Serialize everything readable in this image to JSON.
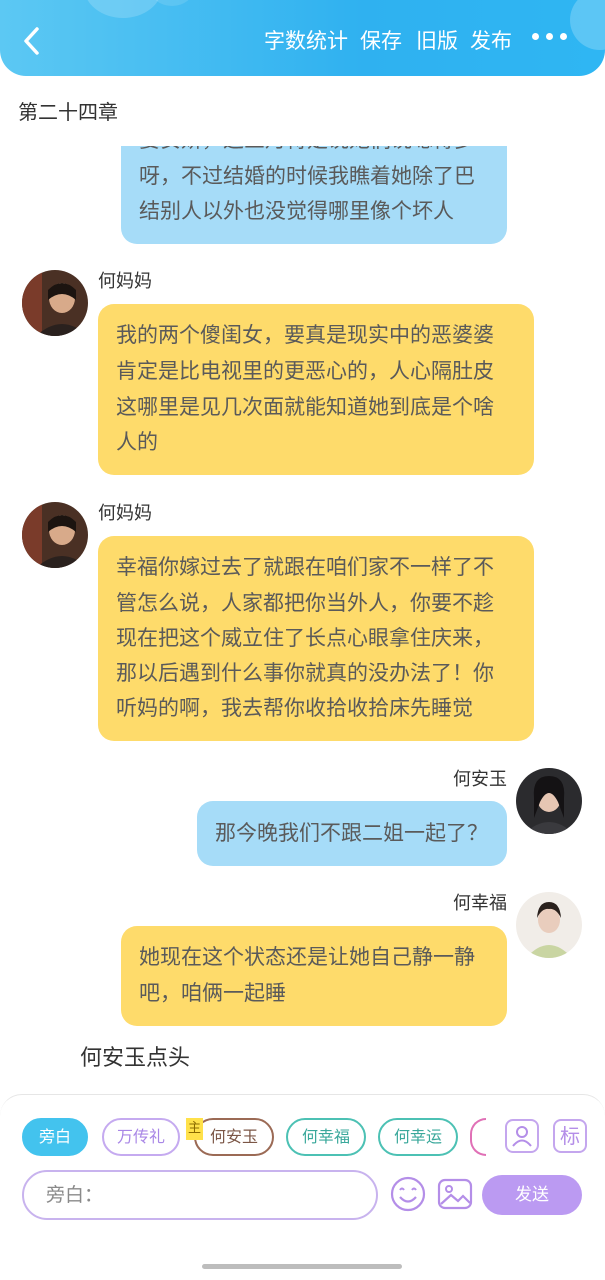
{
  "header": {
    "word_count": "字数统计",
    "save": "保存",
    "old_version": "旧版",
    "publish": "发布"
  },
  "chapter_title": "第二十四章",
  "messages": [
    {
      "speaker": "",
      "text_lines": [
        "要安娇，这三月待是说她们说嗯得多",
        "呀，不过结婚的时候我瞧着她除了巴",
        "结别人以外也没觉得哪里像个坏人"
      ]
    },
    {
      "speaker": "何妈妈",
      "text_lines": [
        "我的两个傻闺女，要真是现实中的恶婆婆",
        "肯定是比电视里的更恶心的，人心隔肚皮",
        "这哪里是见几次面就能知道她到底是个啥",
        "人的"
      ]
    },
    {
      "speaker": "何妈妈",
      "text_lines": [
        "幸福你嫁过去了就跟在咱们家不一样了不",
        "管怎么说，人家都把你当外人，你要不趁",
        "现在把这个威立住了长点心眼拿住庆来，",
        "那以后遇到什么事你就真的没办法了！你",
        "听妈的啊，我去帮你收拾收拾床先睡觉"
      ]
    },
    {
      "speaker": "何安玉",
      "text_lines": [
        "那今晚我们不跟二姐一起了？"
      ]
    },
    {
      "speaker": "何幸福",
      "text_lines": [
        "她现在这个状态还是让她自己静一静",
        "吧，咱俩一起睡"
      ]
    }
  ],
  "narration": "何安玉点头",
  "roles": [
    "旁白",
    "万传礼",
    "何安玉",
    "何幸福",
    "何幸运"
  ],
  "main_badge": "主",
  "tag_icon_label": "标",
  "input_placeholder": "旁白：",
  "send_label": "发送",
  "colors": {
    "header": "#2fb1f0",
    "left_bubble": "#fedb6b",
    "right_bubble": "#a6dcf8",
    "accent_purple": "#bb9af2"
  }
}
